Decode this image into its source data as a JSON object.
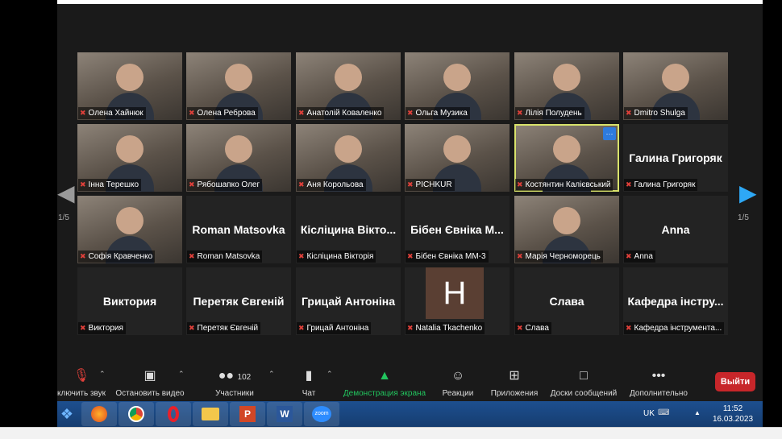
{
  "participants": [
    {
      "name": "Олена Хайнюк",
      "big": null,
      "video": true
    },
    {
      "name": "Олена Реброва",
      "big": null,
      "video": true
    },
    {
      "name": "Анатолій Коваленко",
      "big": null,
      "video": true
    },
    {
      "name": "Ольга Музика",
      "big": null,
      "video": true
    },
    {
      "name": "Лілія Полудень",
      "big": null,
      "video": true
    },
    {
      "name": "Dmitro Shulga",
      "big": null,
      "video": true
    },
    {
      "name": "Інна  Терешко",
      "big": null,
      "video": true
    },
    {
      "name": "Рябошапко Олег",
      "big": null,
      "video": true
    },
    {
      "name": "Аня Корольова",
      "big": null,
      "video": true
    },
    {
      "name": "PICHKUR",
      "big": null,
      "video": true
    },
    {
      "name": "Костянтин Калієвський",
      "big": null,
      "video": true
    },
    {
      "name": "Галина Григоряк",
      "big": "Галина Григоряк",
      "video": false
    },
    {
      "name": "Софія Кравченко",
      "big": null,
      "video": true
    },
    {
      "name": "Roman Matsovka",
      "big": "Roman Matsovka",
      "video": false
    },
    {
      "name": "Кісліцина Вікторія",
      "big": "Кісліцина  Вікто...",
      "video": false
    },
    {
      "name": "Бібен Євніка ММ-3",
      "big": "Бібен Євніка М...",
      "video": false
    },
    {
      "name": "Марія Черноморець",
      "big": null,
      "video": true
    },
    {
      "name": "Anna",
      "big": "Anna",
      "video": false
    },
    {
      "name": "Виктория",
      "big": "Виктория",
      "video": false
    },
    {
      "name": "Перетяк Євгеній",
      "big": "Перетяк Євгеній",
      "video": false
    },
    {
      "name": "Грицай Антоніна",
      "big": "Грицай Антоніна",
      "video": false
    },
    {
      "name": "Natalia Tkachenko",
      "big": null,
      "video": false,
      "avatar": "H"
    },
    {
      "name": "Слава",
      "big": "Слава",
      "video": false
    },
    {
      "name": "Кафедра інструмента...",
      "big": "Кафедра інстру...",
      "video": false
    }
  ],
  "active_speaker": "Костянтин Калієвський",
  "tile_more": "···",
  "page_left": "1/5",
  "page_right": "1/5",
  "toolbar": {
    "mute": "ключить звук",
    "video": "Остановить видео",
    "participants": "Участники",
    "participants_count": "102",
    "chat": "Чат",
    "share": "Демонстрация экрана",
    "reactions": "Реакции",
    "apps": "Приложения",
    "whiteboards": "Доски сообщений",
    "more": "Дополнительно",
    "leave": "Выйти"
  },
  "colors": {
    "share": "#22c55e",
    "leave": "#c7262a",
    "active": "#d8e26b"
  },
  "taskbar": {
    "lang": "UK",
    "time": "11:52",
    "date": "16.03.2023",
    "zoom_label": "zoom",
    "apps": [
      "windows-start",
      "firefox",
      "chrome",
      "opera",
      "explorer",
      "powerpoint",
      "word",
      "zoom"
    ]
  }
}
